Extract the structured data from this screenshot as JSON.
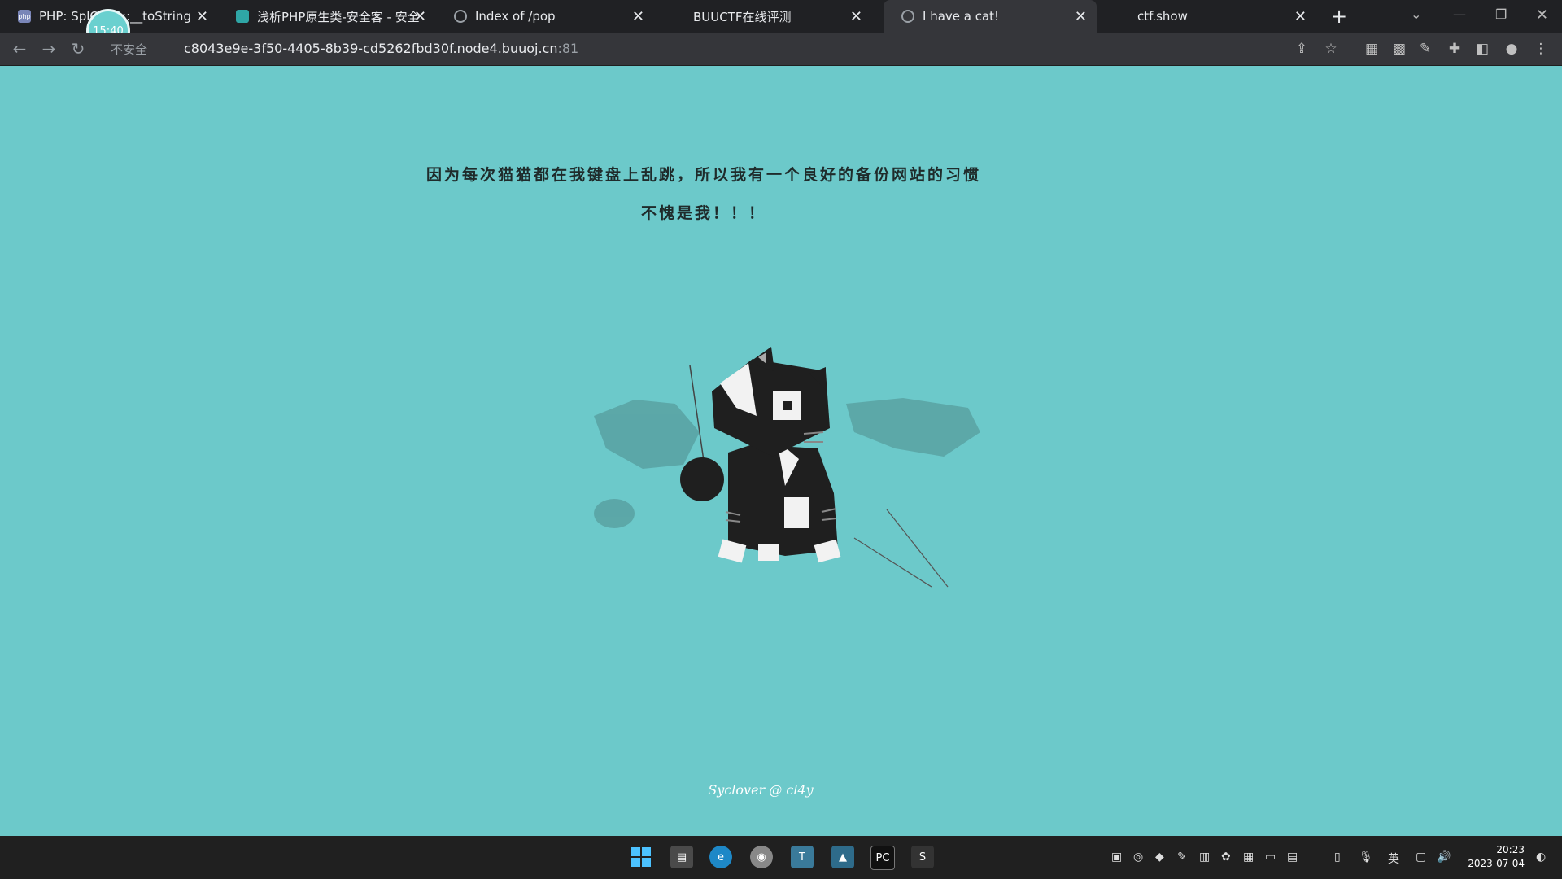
{
  "browser": {
    "tabs": [
      {
        "title": "PHP: SplO...ct::__toString",
        "favicon": "php"
      },
      {
        "title": "浅析PHP原生类-安全客 - 安全资",
        "favicon": "anquanke"
      },
      {
        "title": "Index of /pop",
        "favicon": "globe"
      },
      {
        "title": "BUUCTF在线评测",
        "favicon": "buu"
      },
      {
        "title": "I have a cat!",
        "favicon": "globe",
        "active": true
      },
      {
        "title": "ctf.show",
        "favicon": "ctfshow"
      }
    ],
    "close_glyph": "✕",
    "new_tab": "+",
    "security_label": "不安全",
    "url_host": "c8043e9e-3f50-4405-8b39-cd5262fbd30f.node4.buuoj.cn",
    "url_port": ":81",
    "timer": "15:40"
  },
  "page": {
    "line1": "因为每次猫猫都在我键盘上乱跳，所以我有一个良好的备份网站的习惯",
    "line2": "不愧是我！！！",
    "footer": "Syclover @ cl4y"
  },
  "taskbar": {
    "lang": "英",
    "time": "20:23",
    "date": "2023-07-04",
    "apps": [
      "windows-start",
      "file-explorer",
      "edge",
      "chrome",
      "typora",
      "terminal",
      "pycharm",
      "sublime"
    ]
  },
  "colors": {
    "page_bg": "#6cc9ca",
    "tab_bar": "#202124",
    "toolbar": "#35363a"
  }
}
